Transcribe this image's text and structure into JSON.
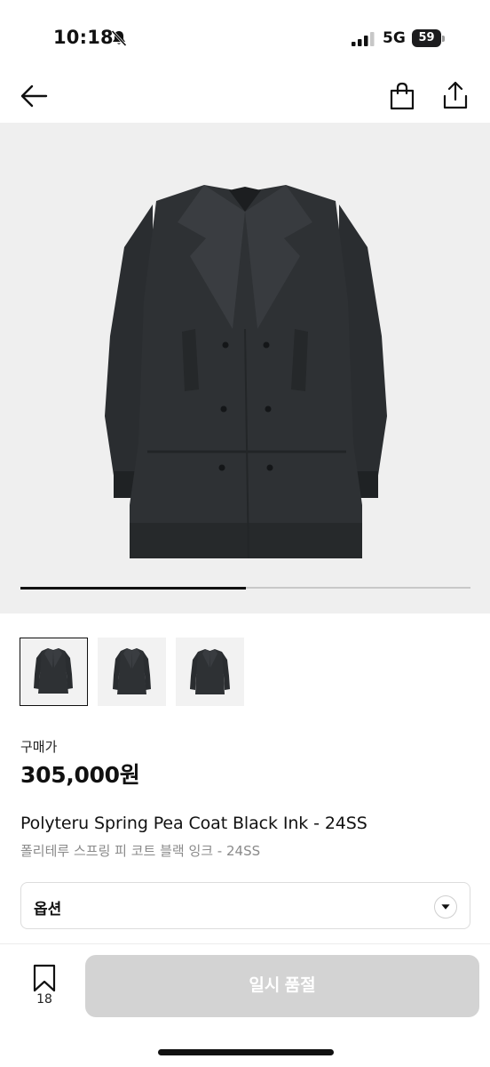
{
  "status_bar": {
    "time": "10:18",
    "network": "5G",
    "battery": "59",
    "icons": [
      "bell-slash-icon",
      "signal-icon",
      "battery-icon"
    ]
  },
  "nav": {
    "icons": [
      "back-arrow-icon",
      "shopping-bag-icon",
      "share-icon"
    ]
  },
  "gallery": {
    "image_count": 3,
    "current_index": 1,
    "progress_fraction": 0.5
  },
  "product": {
    "price_label": "구매가",
    "price": "305,000원",
    "title_en": "Polyteru Spring Pea Coat Black Ink - 24SS",
    "title_ko": "폴리테루 스프링 피 코트 블랙 잉크 - 24SS"
  },
  "option": {
    "label": "옵션",
    "icon": "chevron-down-icon"
  },
  "bottom_bar": {
    "bookmark_count": "18",
    "button_label": "일시 품절"
  },
  "colors": {
    "button_disabled": "#d3d3d3",
    "gallery_bg": "#efefef",
    "coat": "#2b2e31"
  }
}
